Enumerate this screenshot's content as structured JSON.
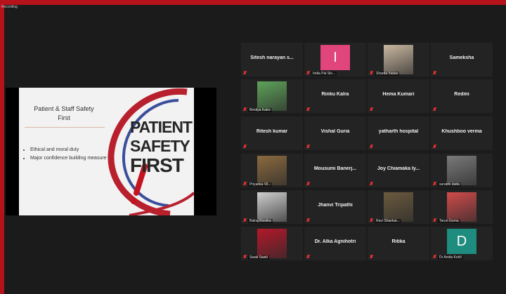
{
  "recording_label": "Recording",
  "shared_screen": {
    "slide_title_line1": "Patient & Staff Safety",
    "slide_title_line2": "First",
    "bullets": [
      "Ethical and moral duty",
      "Major confidence building measure"
    ],
    "logo_line1": "PATIENT",
    "logo_line2": "SAFETY",
    "logo_line3": "FIRST"
  },
  "participants": [
    {
      "name": "Sitesh narayan s...",
      "type": "name"
    },
    {
      "name": "India Pal Sin...",
      "type": "initial",
      "initial": "I",
      "color": "#e0457b"
    },
    {
      "name": "Sharda Yadav",
      "type": "video",
      "tone": "#c9b7a0"
    },
    {
      "name": "Sameksha",
      "type": "name"
    },
    {
      "name": "Bindiya Katre",
      "type": "video",
      "tone": "#5fa35a"
    },
    {
      "name": "Rinku Kalra",
      "type": "name"
    },
    {
      "name": "Hema Kumari",
      "type": "name"
    },
    {
      "name": "Redmi",
      "type": "name"
    },
    {
      "name": "Ritesh kumar",
      "type": "name"
    },
    {
      "name": "Vishal Guria",
      "type": "name"
    },
    {
      "name": "yatharth hospital",
      "type": "name"
    },
    {
      "name": "Khushboo verma",
      "type": "name"
    },
    {
      "name": "Priyanka Vil...",
      "type": "video",
      "tone": "#8b6a3f"
    },
    {
      "name": "Mousumi  Banerj...",
      "type": "name"
    },
    {
      "name": "Joy  Chiamaka Iy...",
      "type": "name"
    },
    {
      "name": "surabhi datta",
      "type": "video",
      "tone": "#7a7a7a"
    },
    {
      "name": "Balraj Bisotka",
      "type": "video",
      "tone": "#cfcfcf"
    },
    {
      "name": "Jhanvi Tripathi",
      "type": "name"
    },
    {
      "name": "Ravi Shankar...",
      "type": "video",
      "tone": "#6b5a3e"
    },
    {
      "name": "Tarun Goma",
      "type": "video",
      "tone": "#d14b4b"
    },
    {
      "name": "Swati Swati",
      "type": "video",
      "tone": "#b3182a"
    },
    {
      "name": "Dr. Alka Agnihotri",
      "type": "name"
    },
    {
      "name": "Ritika",
      "type": "name"
    },
    {
      "name": "Dr Amita Kohli",
      "type": "initial",
      "initial": "D",
      "color": "#1e8c7e"
    }
  ]
}
